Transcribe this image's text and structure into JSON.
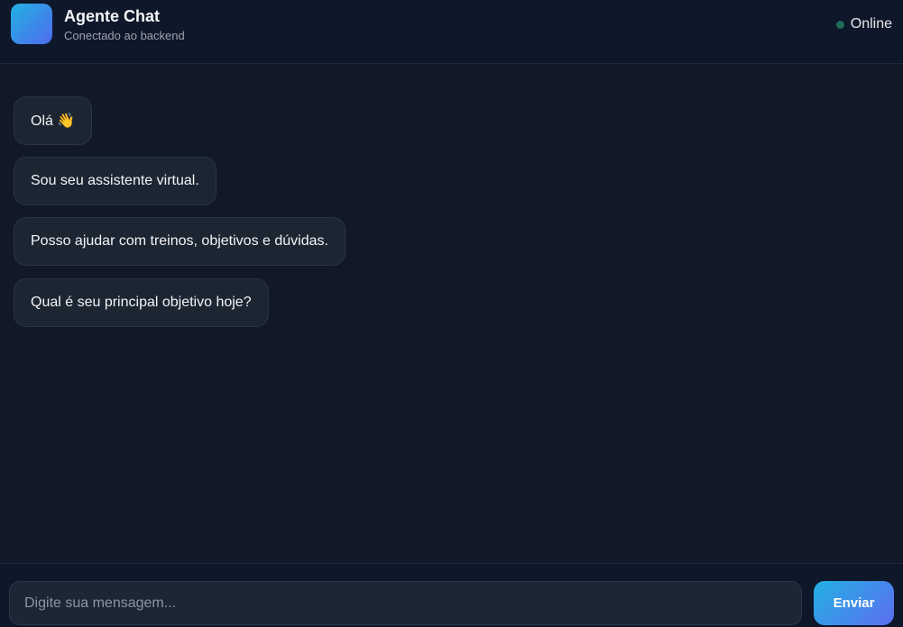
{
  "header": {
    "title": "Agente Chat",
    "subtitle": "Conectado ao backend",
    "status": "Online",
    "status_color": "#1f6b5a",
    "avatar_gradient": [
      "#22b1e3",
      "#4f6bef"
    ]
  },
  "messages": [
    {
      "text": "Olá 👋"
    },
    {
      "text": "Sou seu assistente virtual."
    },
    {
      "text": "Posso ajudar com treinos, objetivos e dúvidas."
    },
    {
      "text": "Qual é seu principal objetivo hoje?"
    }
  ],
  "composer": {
    "placeholder": "Digite sua mensagem...",
    "value": "",
    "send_label": "Enviar"
  },
  "colors": {
    "background": "#111827",
    "header": "#0f172a",
    "bubble": "#1c2532",
    "accent_start": "#22b1e3",
    "accent_end": "#5d6df0"
  }
}
